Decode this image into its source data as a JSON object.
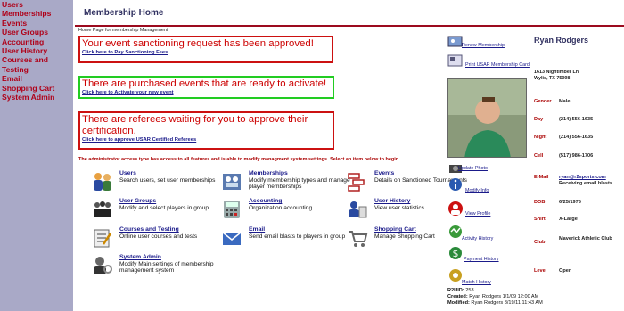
{
  "sidebar": {
    "items": [
      {
        "label": "Users"
      },
      {
        "label": "Memberships"
      },
      {
        "label": "Events"
      },
      {
        "label": "User Groups"
      },
      {
        "label": "Accounting"
      },
      {
        "label": "User History"
      },
      {
        "label": "Courses and Testing"
      },
      {
        "label": "Email"
      },
      {
        "label": "Shopping Cart"
      },
      {
        "label": "System Admin"
      }
    ]
  },
  "header": {
    "title": "Membership Home"
  },
  "breadcrumb": "Home Page for membership Management",
  "alerts": [
    {
      "message": "Your event sanctioning request has been approved!",
      "link": "Click here to Pay Sanctioning Fees"
    },
    {
      "message": "There are purchased events that are ready to activate!",
      "link": "Click here to Activate your new event"
    },
    {
      "message": "There are referees waiting for you to approve their certification.",
      "link": "Click here to approve USAR Certified Referees"
    }
  ],
  "admin_note": "The administrator access type has access to all features and is able to modify managment system settings. Select an item below to begin.",
  "features": [
    {
      "title": "Users",
      "desc": "Search users, set user memberships",
      "icon": "users-icon"
    },
    {
      "title": "Memberships",
      "desc": "Modify membership types and manage player memberships",
      "icon": "memberships-icon"
    },
    {
      "title": "Events",
      "desc": "Details on Sanctioned Tournaments",
      "icon": "events-icon"
    },
    {
      "title": "User Groups",
      "desc": "Modify and select players in group",
      "icon": "user-groups-icon"
    },
    {
      "title": "Accounting",
      "desc": "Organization accounting",
      "icon": "accounting-icon"
    },
    {
      "title": "User History",
      "desc": "View user statistics",
      "icon": "user-history-icon"
    },
    {
      "title": "Courses and Testing",
      "desc": "Online user courses and tests",
      "icon": "courses-icon"
    },
    {
      "title": "Email",
      "desc": "Send email blasts to players in group",
      "icon": "email-icon"
    },
    {
      "title": "Shopping Cart",
      "desc": "Manage Shopping Cart",
      "icon": "shopping-cart-icon"
    },
    {
      "title": "System Admin",
      "desc": "Modify Main settings of membership management system",
      "icon": "system-admin-icon"
    }
  ],
  "side_links": [
    {
      "label": "Renew Membership",
      "icon": "renew-card-icon"
    },
    {
      "label": "Print USAR Membership Card",
      "icon": "membership-card-icon"
    },
    {
      "label": "Update Photo",
      "icon": "camera-icon"
    },
    {
      "label": "Modify Info",
      "icon": "info-icon"
    },
    {
      "label": "View Profile",
      "icon": "profile-icon"
    },
    {
      "label": "Activity History",
      "icon": "activity-icon"
    },
    {
      "label": "Payment History",
      "icon": "payment-icon"
    },
    {
      "label": "Match History",
      "icon": "match-icon"
    }
  ],
  "profile": {
    "name": "Ryan Rodgers",
    "address1": "1613 Nightimber Ln",
    "address2": "Wylie, TX 75098",
    "fields": [
      {
        "label": "Gender",
        "value": "Male"
      },
      {
        "label": "Day",
        "value": "(214) 556-1635"
      },
      {
        "label": "Night",
        "value": "(214) 556-1635"
      },
      {
        "label": "Cell",
        "value": "(517) 986-1706"
      },
      {
        "label": "E-Mail",
        "value": "ryan@r2sports.com",
        "note": "Receiving email blasts"
      },
      {
        "label": "DOB",
        "value": "6/25/1975"
      },
      {
        "label": "Shirt",
        "value": "X-Large"
      },
      {
        "label": "Club",
        "value": "Maverick Athletic Club"
      },
      {
        "label": "Level",
        "value": "Open"
      }
    ]
  },
  "meta": {
    "r2uid_label": "R2UID:",
    "r2uid": "253",
    "created_label": "Created:",
    "created": "Ryan Rodgers 1/1/09 12:00 AM",
    "modified_label": "Modified:",
    "modified": "Ryan Rodgers 8/19/11 11:43 AM"
  },
  "colors": {
    "accent": "#cc0000",
    "nav_bg": "#a9a9c7",
    "link": "#1a1a8a",
    "header_line": "#9c0a1e",
    "alert_red": "#cc1111",
    "alert_green": "#22cc22"
  }
}
